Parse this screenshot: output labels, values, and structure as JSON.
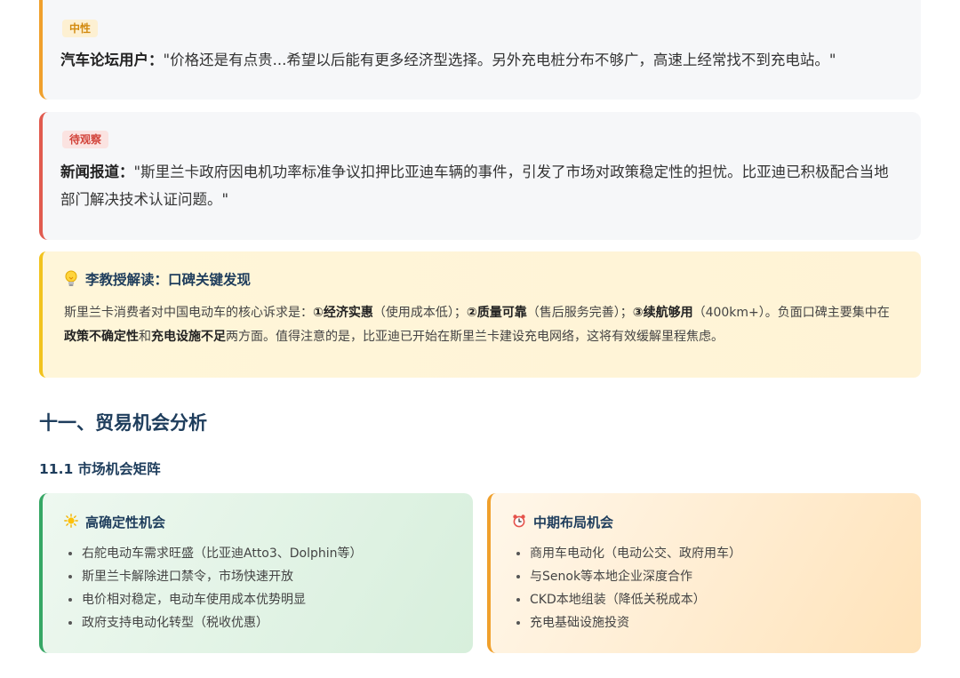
{
  "quotes": [
    {
      "badge": "中性",
      "source": "汽车论坛用户：",
      "text": "\"价格还是有点贵...希望以后能有更多经济型选择。另外充电桩分布不够广，高速上经常找不到充电站。\""
    },
    {
      "badge": "待观察",
      "source": "新闻报道：",
      "text": "\"斯里兰卡政府因电机功率标准争议扣押比亚迪车辆的事件，引发了市场对政策稳定性的担忧。比亚迪已积极配合当地部门解决技术认证问题。\""
    }
  ],
  "insight": {
    "icon": "lightbulb-icon",
    "title": "李教授解读：口碑关键发现",
    "p1": "斯里兰卡消费者对中国电动车的核心诉求是：",
    "k1": "①经济实惠",
    "p2": "（使用成本低）；",
    "k2": "②质量可靠",
    "p3": "（售后服务完善）；",
    "k3": "③续航够用",
    "p4": "（400km+）。负面口碑主要集中在",
    "k4": "政策不确定性",
    "p5": "和",
    "k5": "充电设施不足",
    "p6": "两方面。值得注意的是，比亚迪已开始在斯里兰卡建设充电网络，这将有效缓解里程焦虑。"
  },
  "section": {
    "title": "十一、贸易机会分析",
    "subtitle": "11.1 市场机会矩阵"
  },
  "opportunities": [
    {
      "icon": "sun-icon",
      "title": "高确定性机会",
      "items": [
        "右舵电动车需求旺盛（比亚迪Atto3、Dolphin等）",
        "斯里兰卡解除进口禁令，市场快速开放",
        "电价相对稳定，电动车使用成本优势明显",
        "政府支持电动化转型（税收优惠）"
      ]
    },
    {
      "icon": "alarm-clock-icon",
      "title": "中期布局机会",
      "items": [
        "商用车电动化（电动公交、政府用车）",
        "与Senok等本地企业深度合作",
        "CKD本地组装（降低关税成本）",
        "充电基础设施投资"
      ]
    }
  ],
  "colors": {
    "neutral": "#f0a02c",
    "watch": "#e15b4f",
    "insight": "#f2c31d",
    "high": "#36a765",
    "heading": "#1e3d5c"
  }
}
